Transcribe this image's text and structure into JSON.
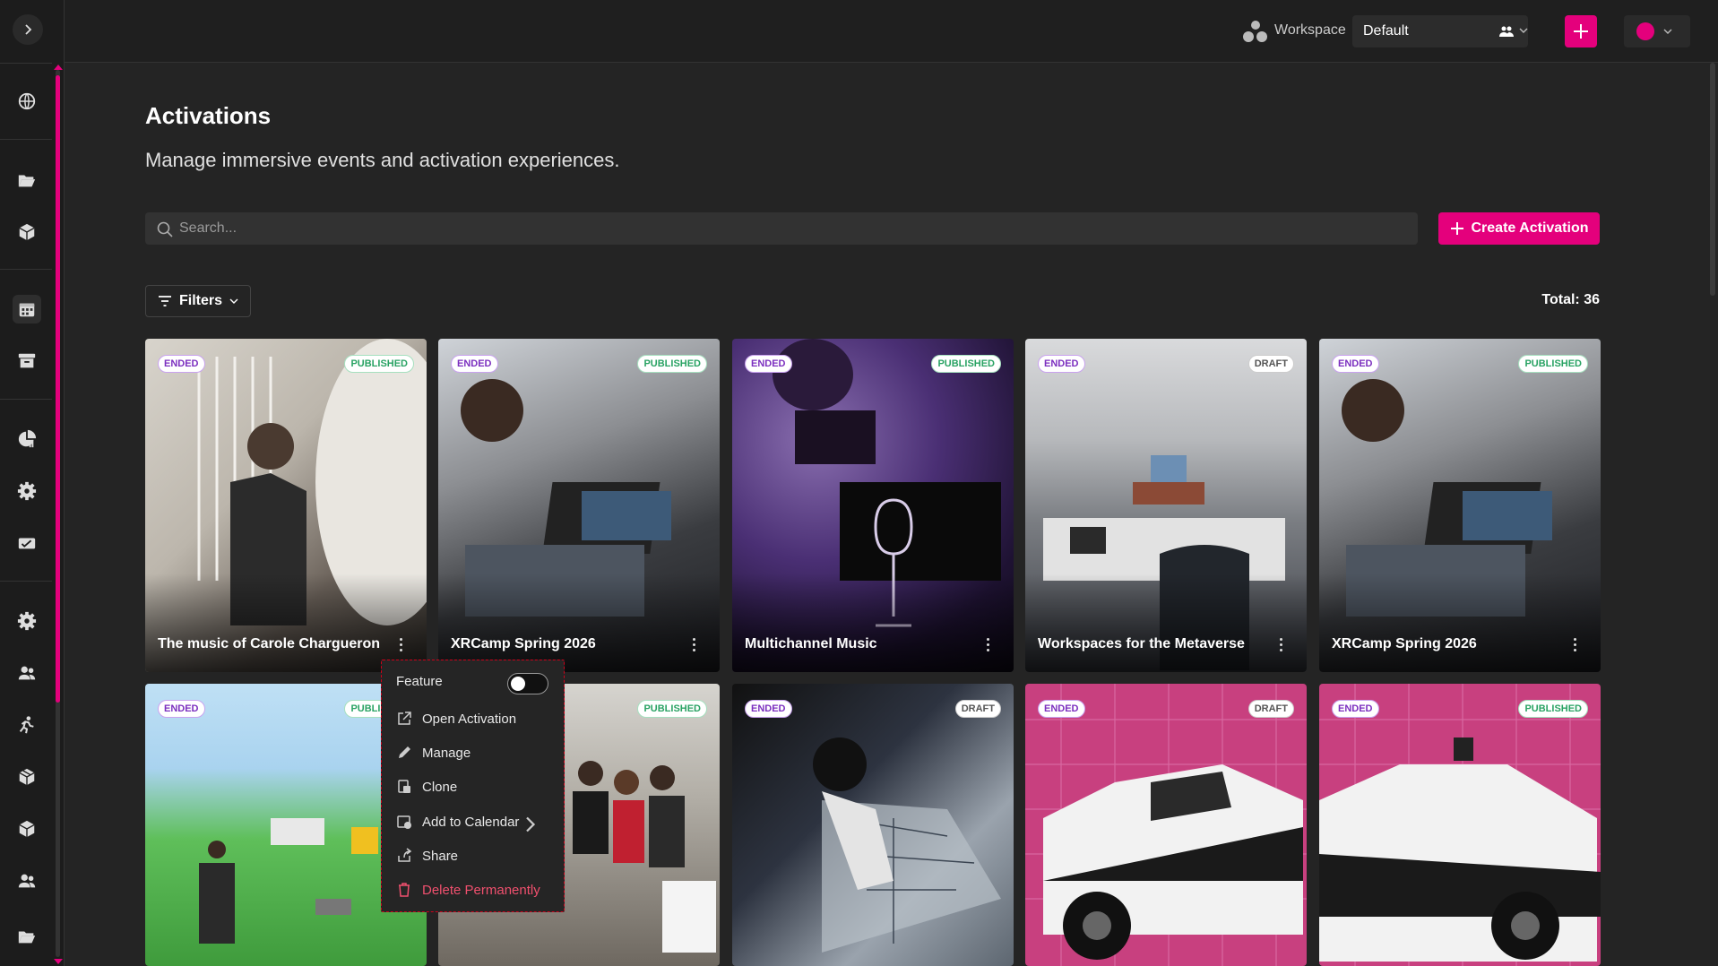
{
  "topbar": {
    "workspace_label": "Workspace",
    "workspace_value": "Default"
  },
  "page": {
    "title": "Activations",
    "subtitle": "Manage immersive events and activation experiences.",
    "search_placeholder": "Search...",
    "create_button": "Create Activation",
    "filters_button": "Filters",
    "total": "Total: 36"
  },
  "cards": [
    {
      "title": "The music of Carole Chargueron",
      "status": "ENDED",
      "state": "PUBLISHED"
    },
    {
      "title": "XRCamp Spring 2026",
      "status": "ENDED",
      "state": "PUBLISHED"
    },
    {
      "title": "Multichannel Music",
      "status": "ENDED",
      "state": "PUBLISHED"
    },
    {
      "title": "Workspaces for the Metaverse",
      "status": "ENDED",
      "state": "DRAFT"
    },
    {
      "title": "XRCamp Spring 2026",
      "status": "ENDED",
      "state": "PUBLISHED"
    },
    {
      "title": "",
      "status": "ENDED",
      "state": "PUBLISHED"
    },
    {
      "title": "",
      "status": "",
      "state": "PUBLISHED"
    },
    {
      "title": "",
      "status": "ENDED",
      "state": "DRAFT"
    },
    {
      "title": "",
      "status": "ENDED",
      "state": "DRAFT"
    },
    {
      "title": "",
      "status": "ENDED",
      "state": "PUBLISHED"
    }
  ],
  "context_menu": {
    "feature": "Feature",
    "feature_on": false,
    "items": [
      "Open Activation",
      "Manage",
      "Clone",
      "Add to Calendar",
      "Share",
      "Delete Permanently"
    ]
  },
  "colors": {
    "accent": "#e4007c",
    "background": "#242424",
    "ended_badge": "#7b2fbf",
    "published_badge": "#2aa364",
    "danger": "#f0506e"
  }
}
